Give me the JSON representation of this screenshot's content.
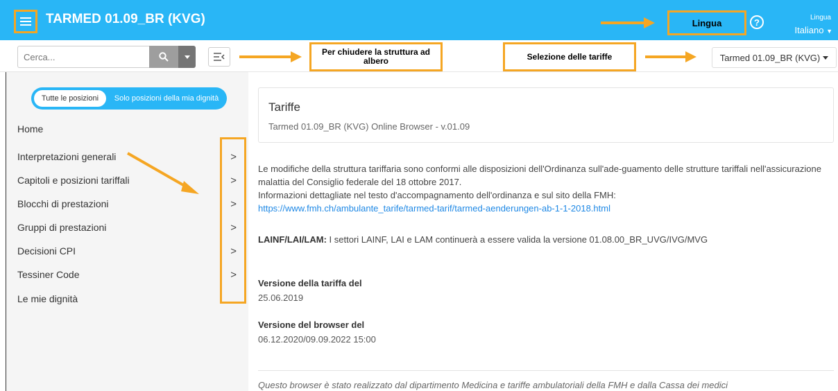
{
  "header": {
    "title": "TARMED 01.09_BR (KVG)",
    "lang_button": "Lingua",
    "help_symbol": "?",
    "lang_caption": "Lingua",
    "lang_value": "Italiano"
  },
  "toolbar": {
    "search_placeholder": "Cerca...",
    "note_tree": "Per chiudere la struttura ad albero",
    "note_tariff": "Selezione delle tariffe",
    "tariff_selected": "Tarmed 01.09_BR (KVG)"
  },
  "sidebar": {
    "toggle_all": "Tutte le posizioni",
    "toggle_mine": "Solo posizioni della mia dignità",
    "items": [
      {
        "label": "Home",
        "chevron": ""
      },
      {
        "label": "Interpretazioni generali",
        "chevron": ">"
      },
      {
        "label": "Capitoli e posizioni tariffali",
        "chevron": ">"
      },
      {
        "label": "Blocchi di prestazioni",
        "chevron": ">"
      },
      {
        "label": "Gruppi di prestazioni",
        "chevron": ">"
      },
      {
        "label": "Decisioni CPI",
        "chevron": ">"
      },
      {
        "label": "Tessiner Code",
        "chevron": ">"
      },
      {
        "label": "Le mie dignità",
        "chevron": ""
      }
    ]
  },
  "main": {
    "card_title": "Tariffe",
    "card_subtitle": "Tarmed 01.09_BR (KVG) Online Browser - v.01.09",
    "para1": "Le modifiche della struttura tariffaria sono conformi alle disposizioni dell'Ordinanza sull'ade-guamento delle strutture tariffali nell'assicurazione malattia del Consiglio federale del 18 ottobre 2017.",
    "para2": "Informazioni dettagliate nel testo d'accompagnamento dell'ordinanza e sul sito della FMH:",
    "link": "https://www.fmh.ch/ambulante_tarife/tarmed-tarif/tarmed-aenderungen-ab-1-1-2018.html",
    "lainf_label": "LAINF/LAI/LAM:",
    "lainf_text": " I settori LAINF, LAI e LAM continuerà a essere valida la versione 01.08.00_BR_UVG/IVG/MVG",
    "tariff_version_label": "Versione della tariffa del",
    "tariff_version_value": "25.06.2019",
    "browser_version_label": "Versione del browser del",
    "browser_version_value": "06.12.2020/09.09.2022 15:00",
    "footer": "Questo browser è stato realizzato dal dipartimento Medicina e tariffe ambulatoriali della FMH e dalla Cassa dei medici"
  },
  "colors": {
    "brand": "#29b6f6",
    "annotation": "#f5a623",
    "link": "#1e88e5"
  }
}
